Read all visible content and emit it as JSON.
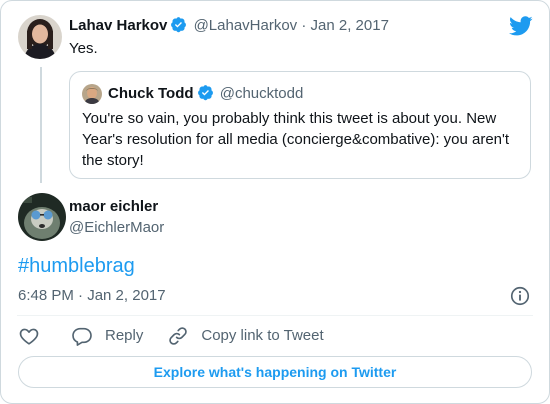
{
  "parent_tweet": {
    "name": "Lahav Harkov",
    "handle": "@LahavHarkov",
    "separator": "·",
    "date": "Jan 2, 2017",
    "text": "Yes."
  },
  "quoted_tweet": {
    "name": "Chuck Todd",
    "handle": "@chucktodd",
    "text": "You're so vain, you probably think this tweet is about you. New Year's resolution for all media (concierge&combative): you aren't the story!"
  },
  "main_tweet": {
    "name": "maor eichler",
    "handle": "@EichlerMaor",
    "hashtag": "#humblebrag",
    "timestamp": "6:48 PM · Jan 2, 2017"
  },
  "actions": {
    "reply_label": "Reply",
    "copy_link_label": "Copy link to Tweet"
  },
  "explore_button_label": "Explore what's happening on Twitter",
  "colors": {
    "twitter_blue": "#1d9bf0",
    "text_primary": "#0f1419",
    "text_secondary": "#536471",
    "border": "#cfd9de"
  },
  "icons": {
    "brand": "twitter-bird-icon",
    "verified": "verified-badge-icon",
    "info": "info-icon",
    "like": "heart-icon",
    "reply": "reply-bubble-icon",
    "copy_link": "link-icon"
  }
}
